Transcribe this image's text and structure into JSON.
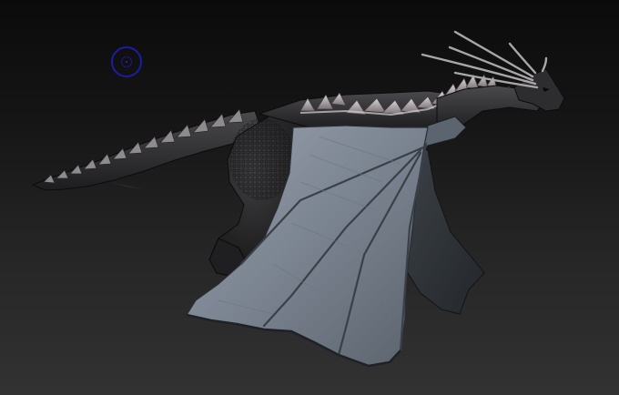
{
  "viewport": {
    "background_top": "#0b0b0b",
    "background_bottom": "#323232"
  },
  "model": {
    "icon": "dragon-sculpt",
    "skin_color": "#2a2a2c",
    "wing_color": "#7c8592",
    "spine_highlight": "#c9c3c8"
  },
  "brush_cursor": {
    "icon": "brush-circle-icon",
    "color": "#1c1ca8"
  }
}
